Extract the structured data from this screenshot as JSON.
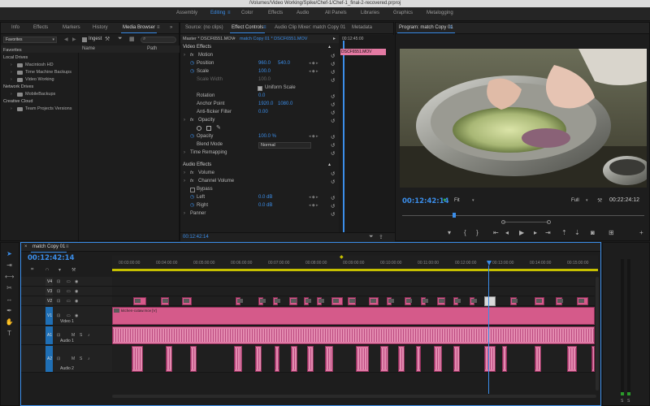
{
  "title_bar": "/Volumes/Video Working/Spike/Chef-1/Chef-1_final-2-recovered.prproj",
  "workspaces": [
    "Assembly",
    "Editing",
    "Color",
    "Effects",
    "Audio",
    "All Panels",
    "Libraries",
    "Graphics",
    "Metalogging"
  ],
  "workspace_active": "Editing",
  "project_panel": {
    "tabs": [
      "Info",
      "Effects",
      "Markers",
      "History",
      "Media Browser"
    ],
    "active_tab": "Media Browser",
    "favorites_select": "Favorites",
    "ingest_label": "Ingest",
    "col_name": "Name",
    "col_path": "Path",
    "tree": [
      {
        "label": "Favorites",
        "indent": 0,
        "section": true
      },
      {
        "label": "Local Drives",
        "indent": 0,
        "section": true
      },
      {
        "label": "Macintosh HD",
        "indent": 1
      },
      {
        "label": "Time Machine Backups",
        "indent": 1
      },
      {
        "label": "Video Working",
        "indent": 1
      },
      {
        "label": "Network Drives",
        "indent": 0,
        "section": true
      },
      {
        "label": "MobileBackups",
        "indent": 1
      },
      {
        "label": "Creative Cloud",
        "indent": 0,
        "section": true
      },
      {
        "label": "Team Projects Versions",
        "indent": 1
      }
    ]
  },
  "effect_controls": {
    "tabs": [
      "Source: (no clips)",
      "Effect Controls",
      "Audio Clip Mixer: match Copy 01",
      "Metadata"
    ],
    "active_tab": "Effect Controls",
    "master_label": "Master * DSCF6551.MOV",
    "seq_label": "match Copy 01 * DSCF6551.MOV",
    "mini_tc": "00:12:45:00",
    "mini_clip": "DSCF6551.MOV",
    "video_effects": "Video Effects",
    "audio_effects": "Audio Effects",
    "rows": [
      {
        "label": "Motion",
        "indent": 1,
        "fx": true
      },
      {
        "label": "Position",
        "indent": 2,
        "v1": "960.0",
        "v2": "540.0",
        "kf": true
      },
      {
        "label": "Scale",
        "indent": 2,
        "v1": "100.0",
        "kf": true
      },
      {
        "label": "Scale Width",
        "indent": 2,
        "v1": "100.0",
        "dim": true
      },
      {
        "label": "Uniform Scale",
        "indent": 3,
        "checkbox": true
      },
      {
        "label": "Rotation",
        "indent": 2,
        "v1": "0.0"
      },
      {
        "label": "Anchor Point",
        "indent": 2,
        "v1": "1920.0",
        "v2": "1080.0"
      },
      {
        "label": "Anti-flicker Filter",
        "indent": 2,
        "v1": "0.00"
      },
      {
        "label": "Opacity",
        "indent": 1,
        "fx": true
      },
      {
        "label": "Opacity",
        "indent": 2,
        "v1": "100.0 %",
        "kf": true
      },
      {
        "label": "Blend Mode",
        "indent": 2,
        "select": "Normal"
      },
      {
        "label": "Time Remapping",
        "indent": 1
      }
    ],
    "audio_rows": [
      {
        "label": "Volume",
        "indent": 1,
        "fx": true
      },
      {
        "label": "Channel Volume",
        "indent": 1,
        "fx": true
      },
      {
        "label": "Bypass",
        "indent": 2,
        "checkbox": true
      },
      {
        "label": "Left",
        "indent": 2,
        "v1": "0.0 dB",
        "kf": true
      },
      {
        "label": "Right",
        "indent": 2,
        "v1": "0.0 dB",
        "kf": true
      },
      {
        "label": "Panner",
        "indent": 1
      }
    ],
    "footer_tc": "00:12:42:14"
  },
  "program_monitor": {
    "tab": "Program: match Copy 01",
    "timecode": "00:12:42:14",
    "fit": "Fit",
    "quality": "Full",
    "duration": "00:22:24:12"
  },
  "timeline": {
    "tab": "match Copy 01",
    "timecode": "00:12:42:14",
    "ruler": [
      "00:03:00:00",
      "00:04:00:00",
      "00:05:00:00",
      "00:06:00:00",
      "00:07:00:00",
      "00:08:00:00",
      "00:09:00:00",
      "00:10:00:00",
      "00:11:00:00",
      "00:12:00:00",
      "00:13:00:00",
      "00:14:00:00",
      "00:15:00:00"
    ],
    "tracks": [
      {
        "id": "V4",
        "label": ""
      },
      {
        "id": "V3",
        "label": ""
      },
      {
        "id": "V2",
        "label": ""
      },
      {
        "id": "V1",
        "label": "Video 1"
      },
      {
        "id": "A1",
        "label": "Audio 1"
      },
      {
        "id": "A2",
        "label": "Audio 2"
      }
    ],
    "v1_clip": "kitchen-cutaw.mov [V]",
    "v2_clip_label": "DSCF",
    "meter_labels": [
      "S",
      "S"
    ]
  },
  "colors": {
    "accent": "#3b8eea",
    "clip": "#d55a8a",
    "audio_clip": "#e07aa5"
  },
  "icons": [
    "pen-icon",
    "search-icon",
    "wrench-icon",
    "funnel-icon",
    "settings-icon",
    "play-icon",
    "step-back-icon",
    "step-forward-icon",
    "mark-in-icon",
    "mark-out-icon",
    "camera-icon",
    "selection-tool-icon",
    "track-select-icon",
    "ripple-edit-icon",
    "razor-icon",
    "slip-icon",
    "pen-tool-icon",
    "hand-icon",
    "type-tool-icon"
  ]
}
